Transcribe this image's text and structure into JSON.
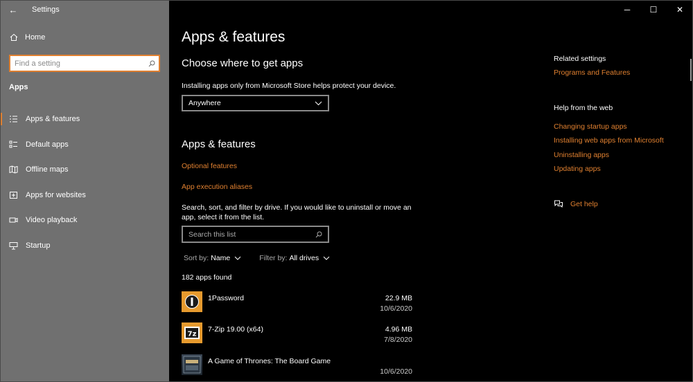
{
  "window": {
    "title": "Settings",
    "back_glyph": "←",
    "minimize_glyph": "─",
    "maximize_glyph": "☐",
    "close_glyph": "✕"
  },
  "sidebar": {
    "home_label": "Home",
    "search_placeholder": "Find a setting",
    "section_title": "Apps",
    "items": [
      {
        "label": "Apps & features",
        "icon": "list-icon",
        "active": true
      },
      {
        "label": "Default apps",
        "icon": "default-apps-icon",
        "active": false
      },
      {
        "label": "Offline maps",
        "icon": "map-icon",
        "active": false
      },
      {
        "label": "Apps for websites",
        "icon": "web-app-icon",
        "active": false
      },
      {
        "label": "Video playback",
        "icon": "video-icon",
        "active": false
      },
      {
        "label": "Startup",
        "icon": "startup-icon",
        "active": false
      }
    ]
  },
  "main": {
    "page_title": "Apps & features",
    "choose_heading": "Choose where to get apps",
    "choose_desc": "Installing apps only from Microsoft Store helps protect your device.",
    "source_value": "Anywhere",
    "section_heading": "Apps & features",
    "optional_features_link": "Optional features",
    "aliases_link": "App execution aliases",
    "search_desc": "Search, sort, and filter by drive. If you would like to uninstall or move an app, select it from the list.",
    "search_placeholder": "Search this list",
    "sort_label": "Sort by:",
    "sort_value": "Name",
    "filter_label": "Filter by:",
    "filter_value": "All drives",
    "apps_count": "182 apps found",
    "apps": [
      {
        "name": "1Password",
        "size": "22.9 MB",
        "date": "10/6/2020",
        "icon_color": "#e69a2e"
      },
      {
        "name": "7-Zip 19.00 (x64)",
        "size": "4.96 MB",
        "date": "7/8/2020",
        "icon_color": "#e69a2e"
      },
      {
        "name": "A Game of Thrones: The Board Game",
        "size": "",
        "date": "10/6/2020",
        "icon_color": "#4a5a6a"
      }
    ]
  },
  "right": {
    "related_heading": "Related settings",
    "related_links": [
      "Programs and Features"
    ],
    "web_heading": "Help from the web",
    "web_links": [
      "Changing startup apps",
      "Installing web apps from Microsoft",
      "Uninstalling apps",
      "Updating apps"
    ],
    "get_help_label": "Get help"
  },
  "colors": {
    "accent": "#e08030",
    "sidebar_bg": "#707070",
    "main_bg": "#000000"
  }
}
